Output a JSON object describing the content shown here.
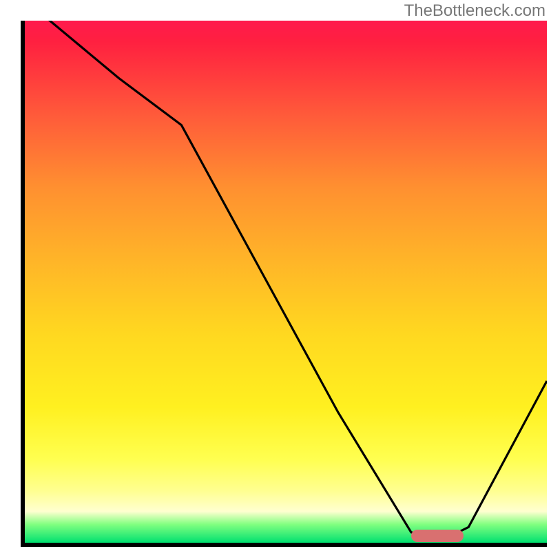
{
  "watermark": "TheBottleneck.com",
  "chart_data": {
    "type": "line",
    "title": "",
    "xlabel": "",
    "ylabel": "",
    "xlim": [
      0,
      100
    ],
    "ylim": [
      0,
      100
    ],
    "x": [
      0,
      18,
      30,
      60,
      74,
      80,
      85,
      100
    ],
    "values": [
      104,
      89,
      80,
      25,
      2,
      0.5,
      3,
      31
    ],
    "gradient_stops": [
      {
        "pos": 0,
        "color": "#ff1a4d"
      },
      {
        "pos": 0.04,
        "color": "#ff2040"
      },
      {
        "pos": 0.18,
        "color": "#ff5a3a"
      },
      {
        "pos": 0.32,
        "color": "#ff9030"
      },
      {
        "pos": 0.46,
        "color": "#ffb528"
      },
      {
        "pos": 0.6,
        "color": "#ffd820"
      },
      {
        "pos": 0.74,
        "color": "#fff020"
      },
      {
        "pos": 0.84,
        "color": "#ffff50"
      },
      {
        "pos": 0.9,
        "color": "#ffff90"
      },
      {
        "pos": 0.94,
        "color": "#ffffd0"
      },
      {
        "pos": 0.965,
        "color": "#80ff80"
      },
      {
        "pos": 1.0,
        "color": "#00e070"
      }
    ],
    "marker": {
      "x_start": 74,
      "x_end": 84,
      "y": 1.3,
      "color": "#d97070"
    }
  }
}
